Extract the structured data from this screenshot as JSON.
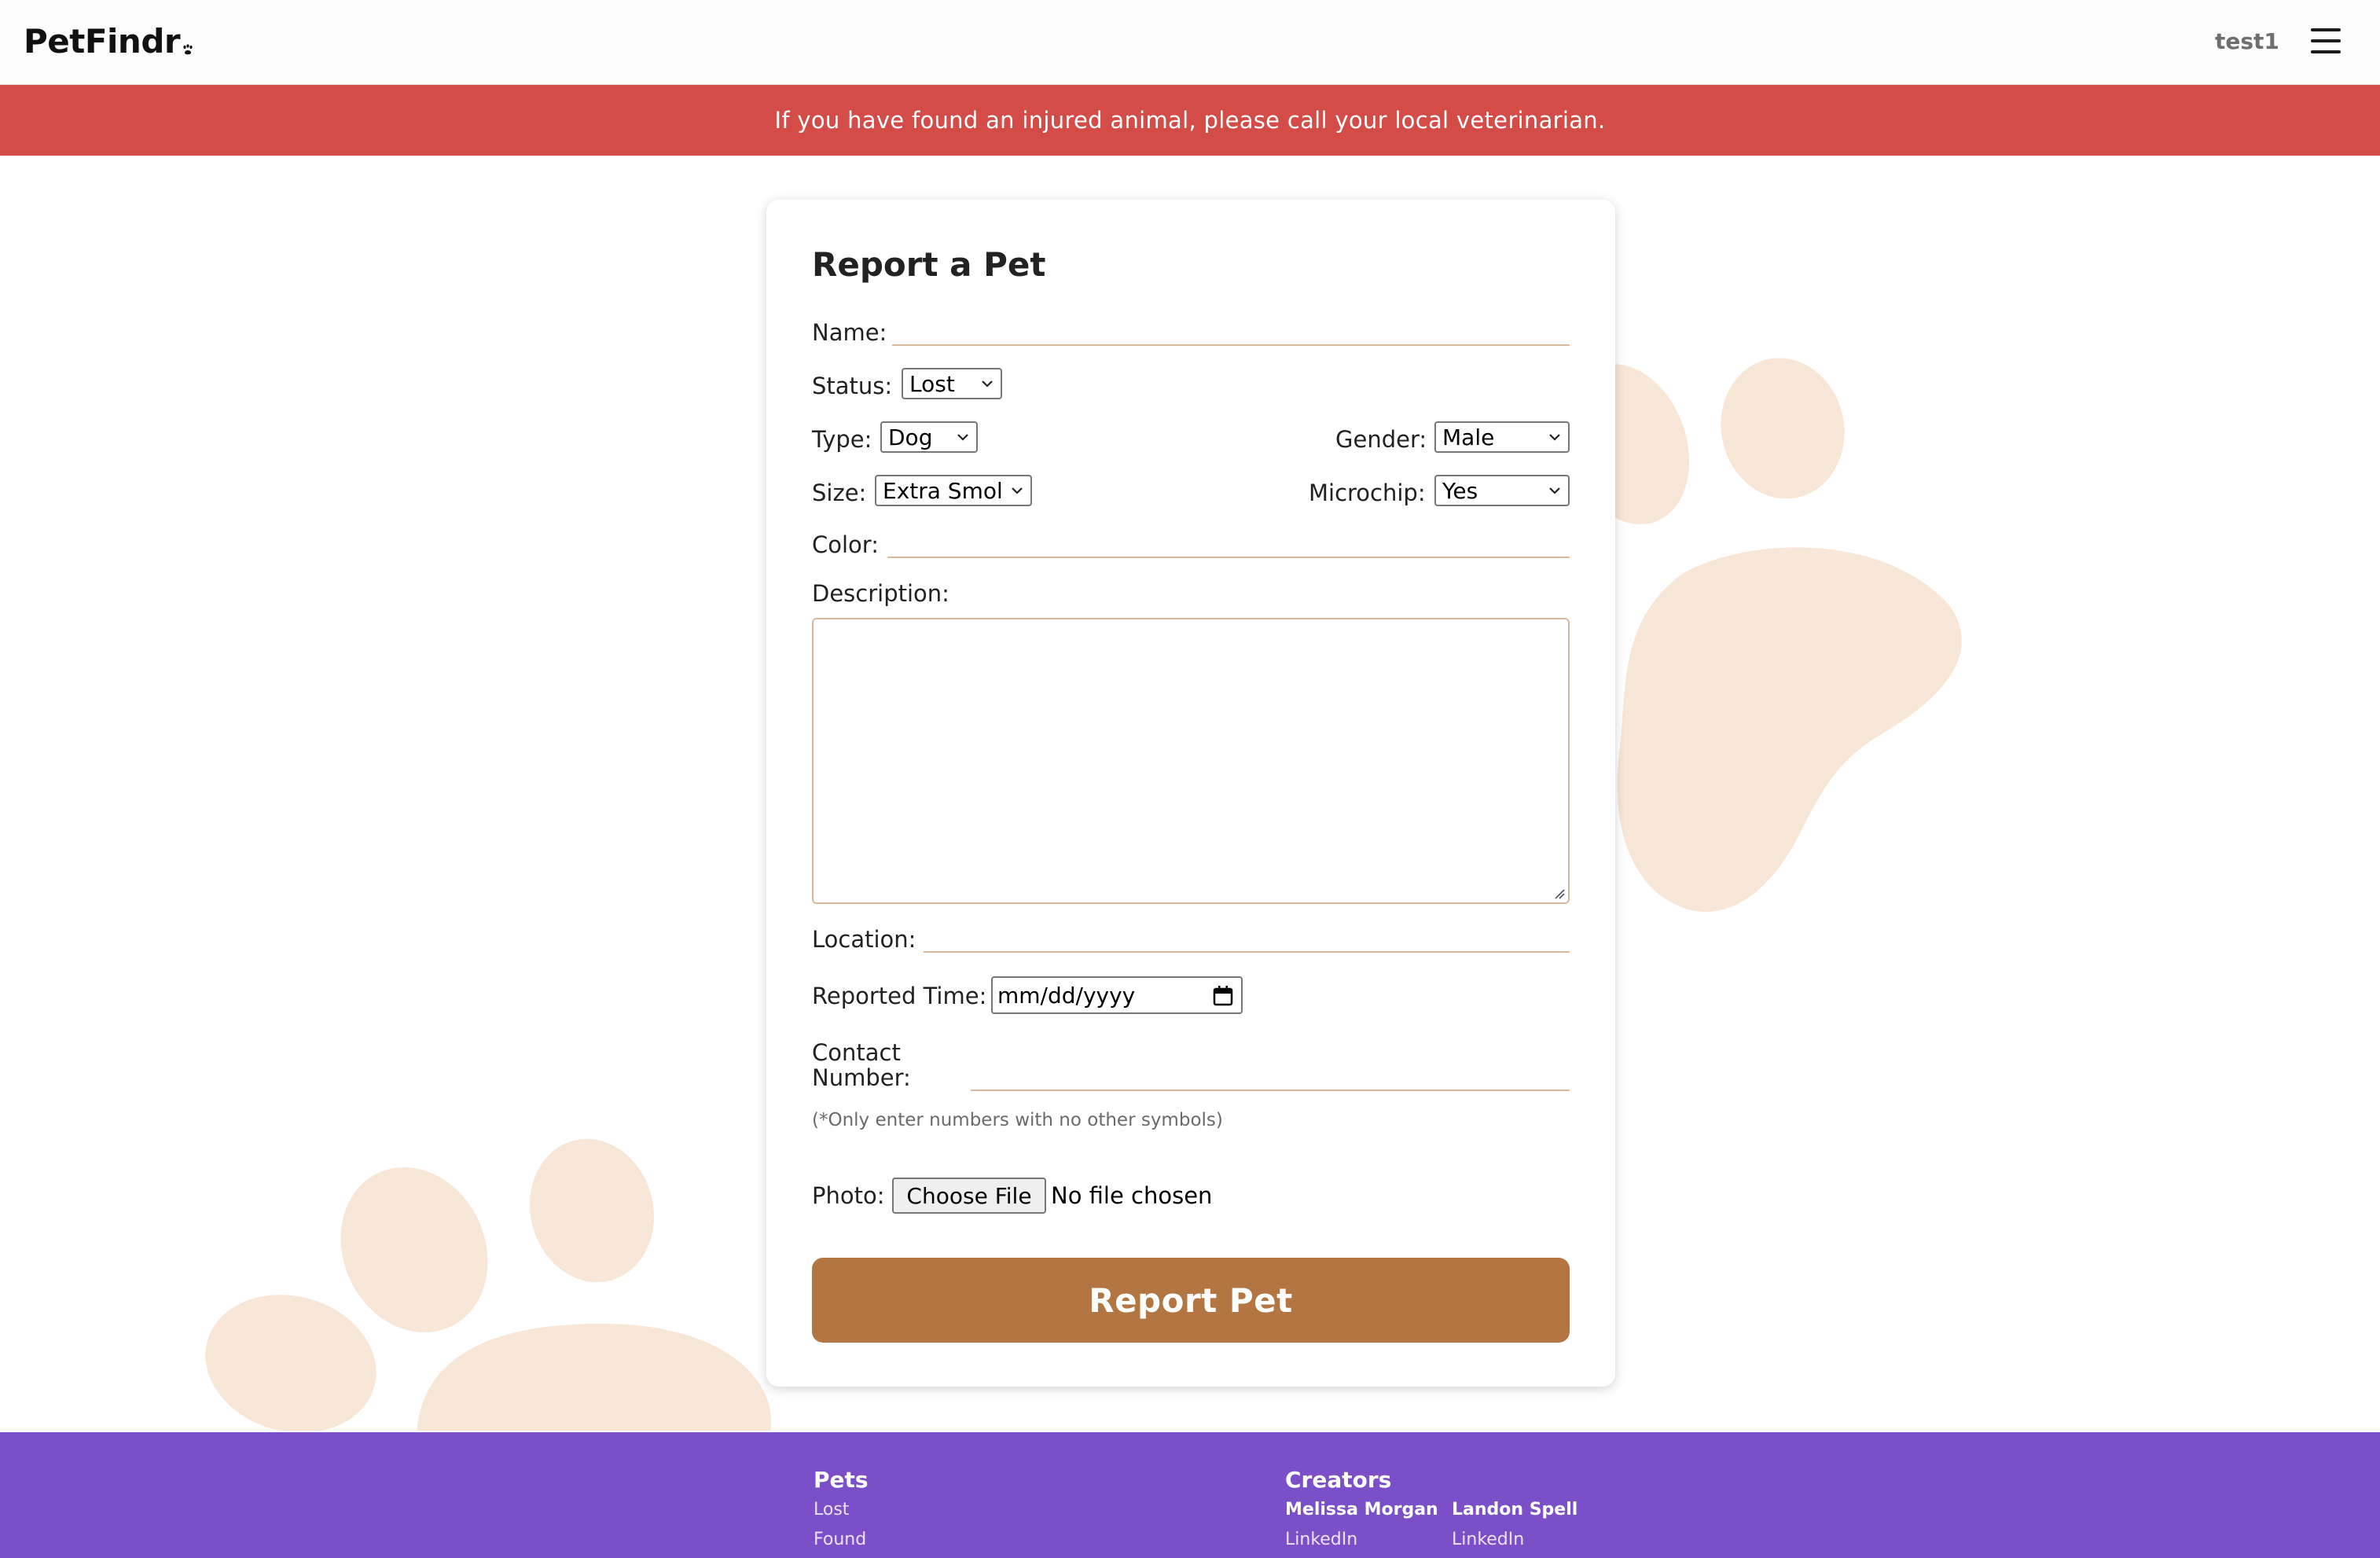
{
  "header": {
    "logo": "PetFindr",
    "username": "test1",
    "menu_icon": "hamburger-menu-icon"
  },
  "alert": {
    "message": "If you have found an injured animal, please call your local veterinarian."
  },
  "form": {
    "title": "Report a Pet",
    "name_label": "Name:",
    "name_value": "",
    "status_label": "Status:",
    "status_value": "Lost",
    "type_label": "Type:",
    "type_value": "Dog",
    "gender_label": "Gender:",
    "gender_value": "Male",
    "size_label": "Size:",
    "size_value": "Extra Smol",
    "microchip_label": "Microchip:",
    "microchip_value": "Yes",
    "color_label": "Color:",
    "color_value": "",
    "description_label": "Description:",
    "description_value": "",
    "location_label": "Location:",
    "location_value": "",
    "reported_time_label": "Reported Time:",
    "reported_time_placeholder": "mm/dd/yyyy",
    "contact_label_line1": "Contact",
    "contact_label_line2": "Number:",
    "contact_value": "",
    "contact_hint": "(*Only enter numbers with no other symbols)",
    "photo_label": "Photo:",
    "choose_file_label": "Choose File",
    "file_status": "No file chosen",
    "submit_label": "Report Pet"
  },
  "footer": {
    "pets_heading": "Pets",
    "pets_links": [
      "Lost",
      "Found"
    ],
    "creators_heading": "Creators",
    "creators": [
      {
        "name": "Melissa Morgan",
        "link": "LinkedIn"
      },
      {
        "name": "Landon Spell",
        "link": "LinkedIn"
      }
    ]
  },
  "colors": {
    "alert": "#d44c47",
    "accent": "#b37642",
    "paw": "#f8e6d6",
    "footer": "#7b4fc8"
  }
}
